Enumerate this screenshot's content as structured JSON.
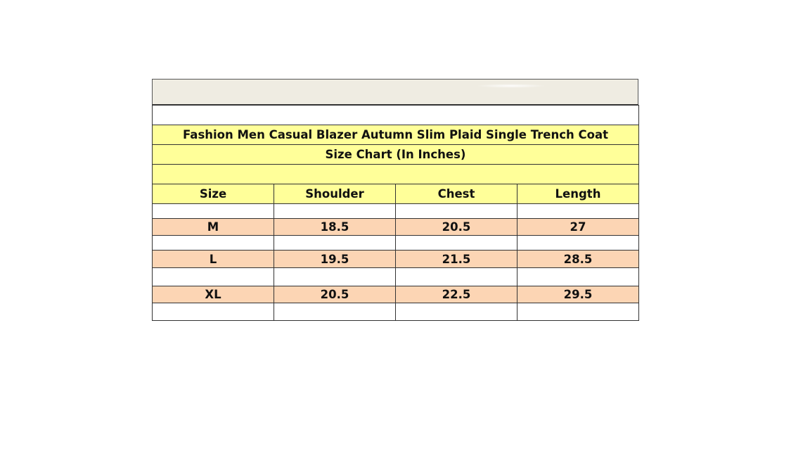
{
  "sheet": {
    "title_line1": "Fashion Men Casual Blazer Autumn Slim Plaid Single Trench Coat",
    "title_line2": "Size Chart (In Inches)"
  },
  "table": {
    "headers": [
      "Size",
      "Shoulder",
      "Chest",
      "Length"
    ],
    "rows": [
      {
        "size": "M",
        "shoulder": "18.5",
        "chest": "20.5",
        "length": "27"
      },
      {
        "size": "L",
        "shoulder": "19.5",
        "chest": "21.5",
        "length": "28.5"
      },
      {
        "size": "XL",
        "shoulder": "20.5",
        "chest": "22.5",
        "length": "29.5"
      }
    ]
  },
  "colors": {
    "banner": "#efece2",
    "header_fill": "#ffff99",
    "row_fill": "#fcd5b4",
    "grid_line": "#333333"
  }
}
